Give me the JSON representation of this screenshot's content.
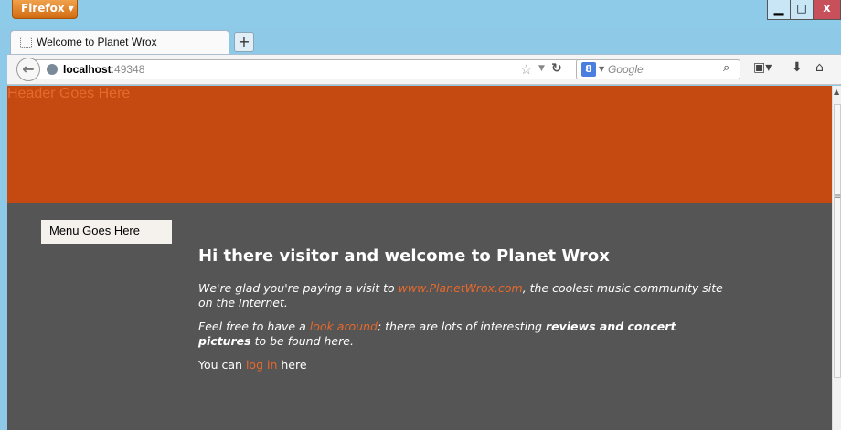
{
  "browser": {
    "menu_button": "Firefox",
    "tab": {
      "title": "Welcome to Planet Wrox"
    },
    "newtab_label": "+",
    "url": {
      "host": "localhost",
      "port": ":49348"
    },
    "search": {
      "placeholder": "Google"
    }
  },
  "page": {
    "header": "Header Goes Here",
    "menu": "Menu Goes Here",
    "heading": "Hi there visitor and welcome to Planet Wrox",
    "p1": {
      "before": "We're glad you're paying a visit to ",
      "link": "www.PlanetWrox.com",
      "after": ", the coolest music community site on the Internet."
    },
    "p2": {
      "before": "Feel free to have a ",
      "link": "look around",
      "middle": "; there are lots of interesting ",
      "bold": "reviews and concert pictures",
      "after": " to be found here."
    },
    "p3": {
      "before": "You can ",
      "link": "log in",
      "after": " here"
    }
  },
  "colors": {
    "header_bg": "#c54a11",
    "page_bg": "#555555",
    "link": "#e8692b"
  }
}
